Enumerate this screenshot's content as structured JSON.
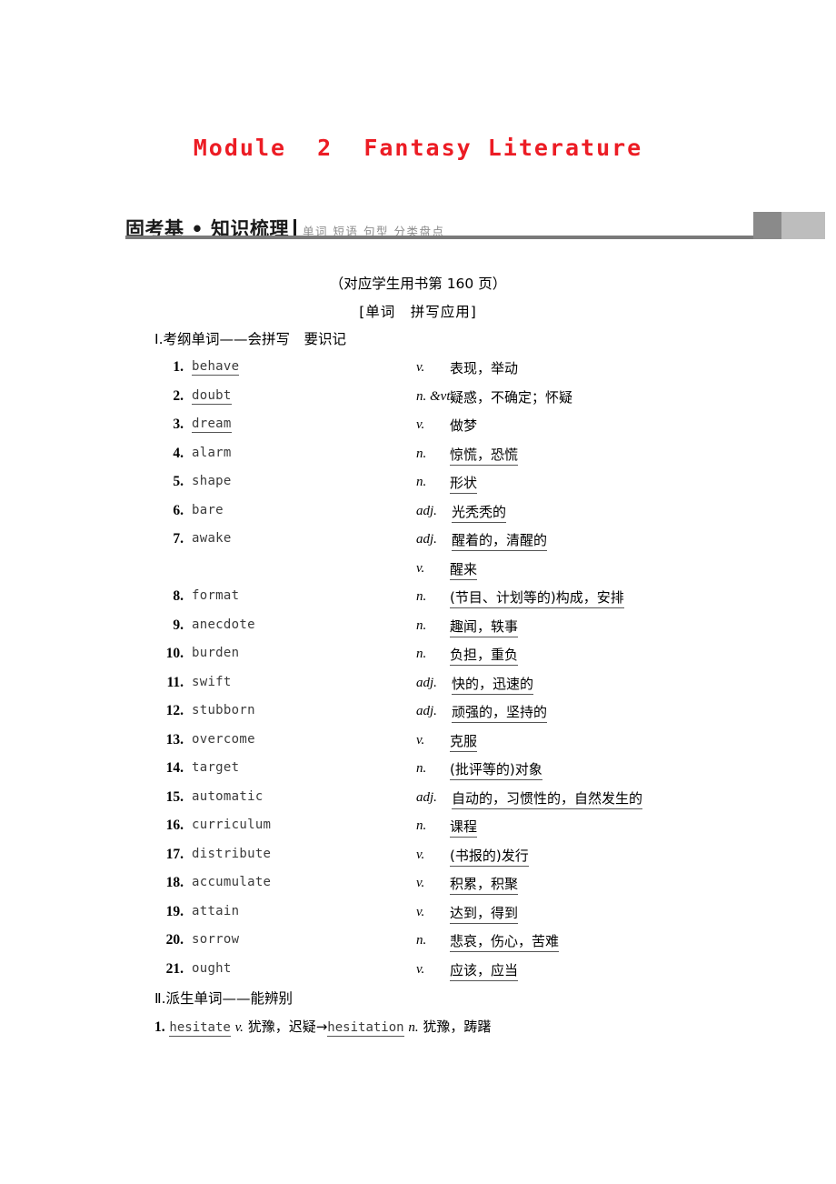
{
  "page": {
    "title": "Module  2  Fantasy Literature",
    "title_color": "#ec1c24"
  },
  "section_header": {
    "title": "固考基 • 知识梳理",
    "subtitle": "单词 短语 句型 分类盘点",
    "rule_color": "#7a7a7a",
    "block_dark": "#8a8a8a",
    "block_light": "#bdbdbd"
  },
  "notes": {
    "book_reference": "（对应学生用书第 160 页）",
    "topic": "[单词　拼写应用]"
  },
  "sections": {
    "part1_heading": "Ⅰ.考纲单词——会拼写　要识记",
    "part2_heading": "Ⅱ.派生单词——能辨别"
  },
  "words": [
    {
      "num": "1.",
      "word": "behave",
      "word_underline": true,
      "pos": "v.",
      "pos_wide": false,
      "def": "表现，举动",
      "def_underline": false
    },
    {
      "num": "2.",
      "word": "doubt",
      "word_underline": true,
      "pos": "n. &vt.",
      "pos_wide": false,
      "def": "疑惑，不确定；怀疑",
      "def_underline": false
    },
    {
      "num": "3.",
      "word": "dream",
      "word_underline": true,
      "pos": "v.",
      "pos_wide": false,
      "def": "做梦",
      "def_underline": false
    },
    {
      "num": "4.",
      "word": "alarm",
      "word_underline": false,
      "pos": "n.",
      "pos_wide": false,
      "def": "惊慌，恐慌",
      "def_underline": true
    },
    {
      "num": "5.",
      "word": "shape",
      "word_underline": false,
      "pos": "n.",
      "pos_wide": false,
      "def": "形状",
      "def_underline": true
    },
    {
      "num": "6.",
      "word": "bare",
      "word_underline": false,
      "pos": "adj.",
      "pos_wide": true,
      "def": "光秃秃的",
      "def_underline": true
    },
    {
      "num": "7.",
      "word": "awake",
      "word_underline": false,
      "pos": "adj.",
      "pos_wide": true,
      "def": "醒着的，清醒的",
      "def_underline": true
    },
    {
      "num": "",
      "word": "",
      "word_underline": false,
      "pos": "v.",
      "pos_wide": false,
      "def": "醒来",
      "def_underline": true
    },
    {
      "num": "8.",
      "word": "format",
      "word_underline": false,
      "pos": "n.",
      "pos_wide": false,
      "def": "(节目、计划等的)构成，安排",
      "def_underline": true
    },
    {
      "num": "9.",
      "word": "anecdote",
      "word_underline": false,
      "pos": "n.",
      "pos_wide": false,
      "def": "趣闻，轶事",
      "def_underline": true
    },
    {
      "num": "10.",
      "word": "burden",
      "word_underline": false,
      "pos": "n.",
      "pos_wide": false,
      "def": "负担，重负",
      "def_underline": true
    },
    {
      "num": "11.",
      "word": "swift",
      "word_underline": false,
      "pos": "adj.",
      "pos_wide": true,
      "def": "快的，迅速的",
      "def_underline": true
    },
    {
      "num": "12.",
      "word": "stubborn",
      "word_underline": false,
      "pos": "adj.",
      "pos_wide": true,
      "def": "顽强的，坚持的",
      "def_underline": true
    },
    {
      "num": "13.",
      "word": "overcome",
      "word_underline": false,
      "pos": "v.",
      "pos_wide": false,
      "def": "克服",
      "def_underline": true
    },
    {
      "num": "14.",
      "word": "target",
      "word_underline": false,
      "pos": "n.",
      "pos_wide": false,
      "def": "(批评等的)对象",
      "def_underline": true
    },
    {
      "num": "15.",
      "word": "automatic",
      "word_underline": false,
      "pos": "adj.",
      "pos_wide": true,
      "def": "自动的，习惯性的，自然发生的",
      "def_underline": true
    },
    {
      "num": "16.",
      "word": "curriculum",
      "word_underline": false,
      "pos": "n.",
      "pos_wide": false,
      "def": "课程",
      "def_underline": true
    },
    {
      "num": "17.",
      "word": "distribute",
      "word_underline": false,
      "pos": "v.",
      "pos_wide": false,
      "def": "(书报的)发行",
      "def_underline": true
    },
    {
      "num": "18.",
      "word": "accumulate",
      "word_underline": false,
      "pos": "v.",
      "pos_wide": false,
      "def": "积累，积聚",
      "def_underline": true
    },
    {
      "num": "19.",
      "word": "attain",
      "word_underline": false,
      "pos": "v.",
      "pos_wide": false,
      "def": "达到，得到",
      "def_underline": true
    },
    {
      "num": "20.",
      "word": "sorrow",
      "word_underline": false,
      "pos": "n.",
      "pos_wide": false,
      "def": "悲哀，伤心，苦难",
      "def_underline": true
    },
    {
      "num": "21.",
      "word": "ought",
      "word_underline": false,
      "pos": "v.",
      "pos_wide": false,
      "def": "应该，应当",
      "def_underline": true
    }
  ],
  "derived_words": [
    {
      "num": "1.",
      "base": "hesitate",
      "base_pos": "v.",
      "base_def": "犹豫，迟疑",
      "arrow": "→",
      "derived": "hesitation",
      "derived_pos": "n.",
      "derived_def": "犹豫，踌躇"
    }
  ]
}
